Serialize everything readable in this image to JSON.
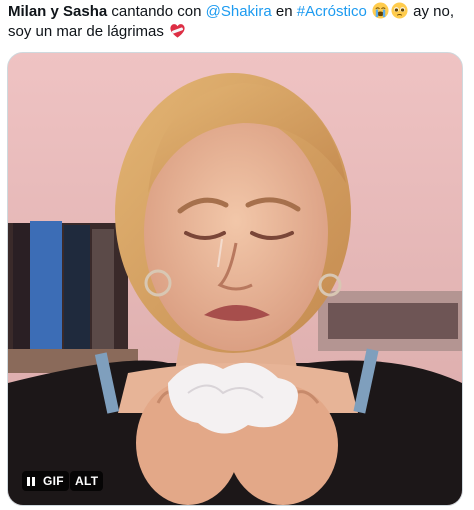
{
  "tweet": {
    "author_names": "Milan y Sasha",
    "text_part1": " cantando con ",
    "mention": "@Shakira",
    "text_part2": " en ",
    "hashtag": "#Acróstico",
    "text_part3": " ay no, soy un mar de lágrimas",
    "emojis": [
      "loudly-crying-face",
      "pleading-face",
      "mending-heart"
    ]
  },
  "media": {
    "type": "gif",
    "controls": {
      "pause_icon": "pause-icon",
      "gif_label": "GIF",
      "alt_label": "ALT"
    }
  },
  "colors": {
    "text": "#0f1419",
    "link": "#1d9bf0",
    "border": "#cfd9de",
    "badge_bg": "#000000"
  }
}
